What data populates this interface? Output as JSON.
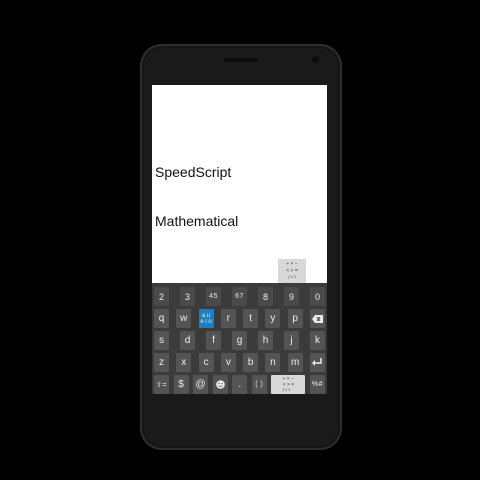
{
  "screen": {
    "line1": "SpeedScript",
    "line2": "Mathematical"
  },
  "suggestion_popup": {
    "symbols": "÷ × −\n< > =\n/ ² ³"
  },
  "keyboard": {
    "row_numbers": [
      "2",
      "3",
      "45",
      "67",
      "8",
      "9",
      "0"
    ],
    "row1_before": [
      "q",
      "w"
    ],
    "row1_active": {
      "top": "a u",
      "bottom": "e i o"
    },
    "row1_after": [
      "r",
      "t",
      "y",
      "p"
    ],
    "row2": [
      "s",
      "d",
      "f",
      "g",
      "h",
      "j",
      "k"
    ],
    "row3": [
      "z",
      "x",
      "c",
      "v",
      "b",
      "n",
      "m"
    ],
    "row4": {
      "shift_label": "⇧=",
      "dollar": "$",
      "at": "@",
      "period": ".",
      "parens": "( )",
      "percent_hash": "%#"
    },
    "accent_color": "#1d7fc1"
  },
  "icons": [
    "backspace-icon",
    "enter-icon",
    "emoji-icon",
    "shift-icon"
  ]
}
